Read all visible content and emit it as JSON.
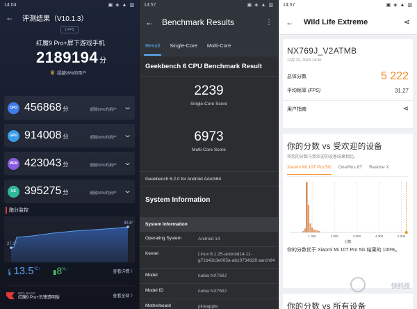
{
  "antutu": {
    "status": {
      "time": "14:04",
      "icons": "▣ ◈ ▲ ▥"
    },
    "header_title": "评测结果（V10.1.3）",
    "fps_badge": "1 FPS",
    "device": "红魔9 Pro+屏下游戏手机",
    "score": "2189194",
    "score_unit": "分",
    "beat_text": "超越99%的用户",
    "rows": [
      {
        "cat": "CPU",
        "value": "456868",
        "unit": "分",
        "beat": "超越99%的用户",
        "color": "#3f7ce8"
      },
      {
        "cat": "GPU",
        "value": "914008",
        "unit": "分",
        "beat": "超越99%的用户",
        "color": "#3a9be8"
      },
      {
        "cat": "MEM",
        "value": "423043",
        "unit": "分",
        "beat": "超越99%的用户",
        "color": "#8a5ae0"
      },
      {
        "cat": "UX",
        "value": "395275",
        "unit": "分",
        "beat": "超越99%的用户",
        "color": "#2fb89e"
      }
    ],
    "monitor_title": "跑分监控",
    "temp_start": "27.2°",
    "temp_end": "40.8°",
    "temp_rise": "13.5",
    "temp_unit": "°C↑",
    "battery_drop": "8",
    "battery_unit": "%↓",
    "detail_link": "查看详情 〉",
    "footer_text_1": "RED MAGIC",
    "footer_text_2": "红魔9 Pro+氘锋透明版",
    "footer_more": "查看全部 〉"
  },
  "geekbench": {
    "status": {
      "time": "14:57",
      "icons": "▣ ◈ ▲ ▥"
    },
    "title": "Benchmark Results",
    "menu_icon": "⋮",
    "tabs": [
      "Result",
      "Single-Core",
      "Multi-Core"
    ],
    "card_title": "Geekbench 6 CPU Benchmark Result",
    "single_score": "2239",
    "single_label": "Single-Core Score",
    "multi_score": "6973",
    "multi_label": "Multi-Core Score",
    "version": "Geekbench 6.2.0 for Android AArch64",
    "section": "System Information",
    "table_header": "System Information",
    "rows": [
      {
        "k": "Operating System",
        "v": "Android 14"
      },
      {
        "k": "Kernel",
        "v": "Linux 6.1.25-android14-11-g71b43c3e005a-ab10734328 aarch64"
      },
      {
        "k": "Model",
        "v": "nubia NX769J"
      },
      {
        "k": "Model ID",
        "v": "nubia NX769J"
      },
      {
        "k": "Motherboard",
        "v": "pineapple"
      }
    ]
  },
  "threedmark": {
    "status": {
      "time": "14:57",
      "icons": "▣ ◈ ▲ ▥"
    },
    "title": "Wild Life Extreme",
    "device": "NX769J_V2ATMB",
    "date": "11月 22, 2023 14:30",
    "total_label": "总体分数",
    "total_value": "5 222",
    "fps_label": "平均帧率",
    "fps_label_en": "(FPS)",
    "fps_value": "31.27",
    "guide_label": "用户指南",
    "compare_title": "你的分数 vs 受欢迎的设备",
    "compare_sub": "将您的分数与受欢迎的设备结果相比。",
    "compare_tabs": [
      "Xiaomi Mi 10T Pro 5G",
      "OnePlus 8T",
      "Realme X"
    ],
    "note": "你的分数优于 Xiaomi Mi 10T Pro 5G 结果的 100%。",
    "next_title": "你的分数 vs 所有设备",
    "watermark": "快科技"
  },
  "chart_data": {
    "type": "bar",
    "xlabel": "分数",
    "x_ticks": [
      "1 000",
      "2 000",
      "3 000",
      "4 000",
      "5 000"
    ],
    "xlim": [
      0,
      5200
    ],
    "x": [
      600,
      680,
      760,
      840,
      920,
      1000,
      1080,
      1160,
      1240,
      1320
    ],
    "values": [
      3,
      8,
      100,
      55,
      18,
      10,
      6,
      5,
      4,
      3
    ],
    "marker_x": 5222,
    "colors": {
      "bar": "#e0a070",
      "bar_dark": "#d07a40",
      "marker": "#f28b24"
    }
  },
  "colors": {
    "accent_orange": "#f28b24",
    "geek_blue": "#5fb0ff",
    "antutu_temp": "#5aa0f0",
    "antutu_bat": "#4fc06a"
  }
}
